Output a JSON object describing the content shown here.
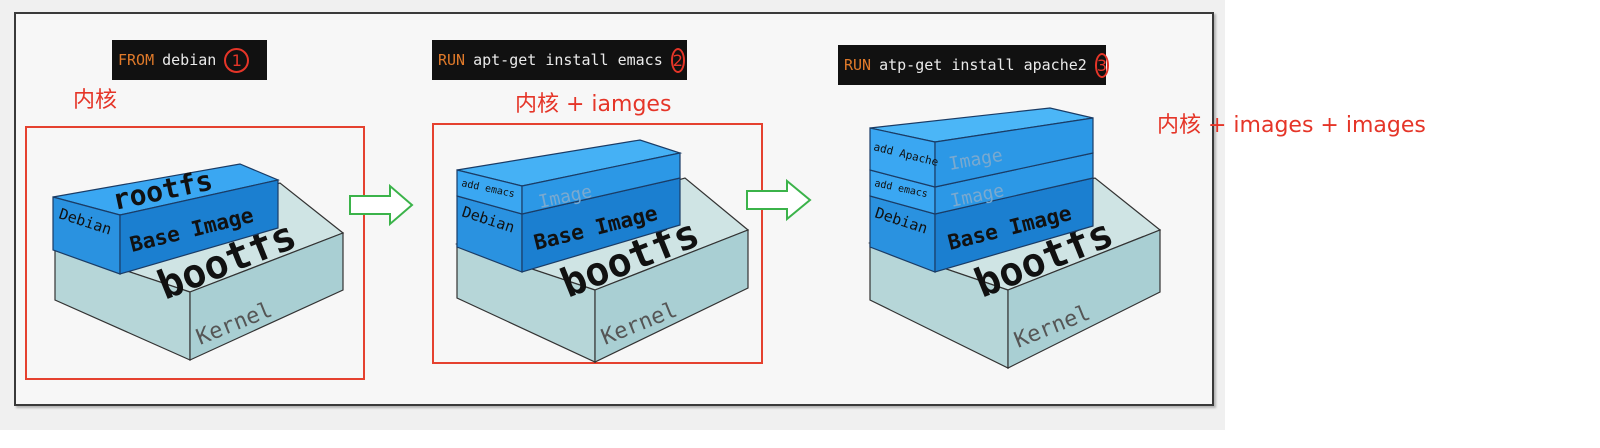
{
  "steps": [
    {
      "keyword": "FROM",
      "text": "debian",
      "number": "1"
    },
    {
      "keyword": "RUN",
      "text": "apt-get install emacs",
      "number": "2"
    },
    {
      "keyword": "RUN",
      "text": "atp-get install apache2",
      "number": "3"
    }
  ],
  "notes": {
    "kernel": "内核",
    "kernel_iamges": "内核 + iamges",
    "kernel_images_images": "内核 + images  + images"
  },
  "layers": {
    "kernel": "Kernel",
    "bootfs": "bootfs",
    "rootfs": "rootfs",
    "debian": "Debian",
    "base_image": "Base Image",
    "add_emacs": "add emacs",
    "add_apache": "add Apache",
    "image": "Image"
  },
  "colors": {
    "kernel_top": "#cfe4e4",
    "kernel_front": "#a9cfd3",
    "base_blue_top": "#3aa7f2",
    "base_blue_front": "#1b7fd0",
    "accent_red": "#e53528",
    "arrow_green": "#3bb34a"
  }
}
